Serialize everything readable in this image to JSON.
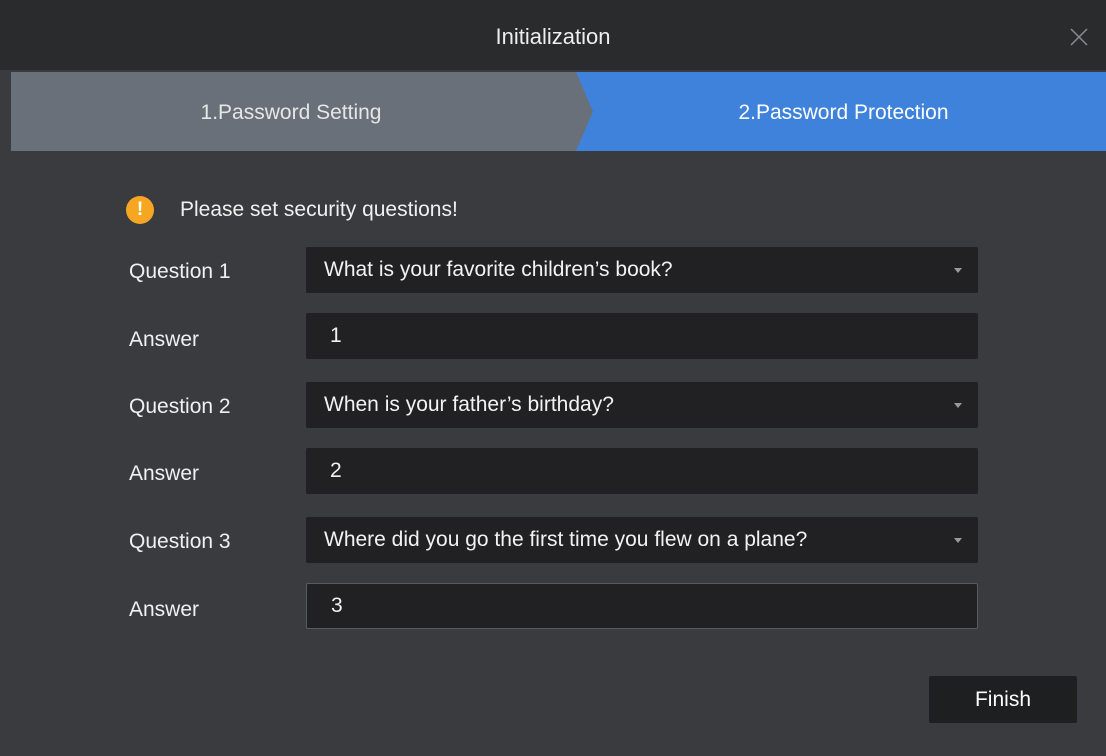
{
  "window": {
    "title": "Initialization",
    "close_icon": "close-icon"
  },
  "steps": [
    {
      "label": "1.Password Setting",
      "state": "completed",
      "color": "#6a7079"
    },
    {
      "label": "2.Password Protection",
      "state": "active",
      "color": "#3e82dc"
    }
  ],
  "notice": {
    "icon": "warning-icon",
    "icon_color": "#f5a623",
    "icon_glyph": "!",
    "text": "Please set security questions!"
  },
  "fields": {
    "question1": {
      "label": "Question 1",
      "value": "What is your favorite children’s book?"
    },
    "answer1": {
      "label": "Answer",
      "value": "1"
    },
    "question2": {
      "label": "Question 2",
      "value": "When is your father’s birthday?"
    },
    "answer2": {
      "label": "Answer",
      "value": "2"
    },
    "question3": {
      "label": "Question 3",
      "value": "Where did you go the first time you flew on a plane?"
    },
    "answer3": {
      "label": "Answer",
      "value": "3"
    }
  },
  "footer": {
    "finish_label": "Finish"
  }
}
